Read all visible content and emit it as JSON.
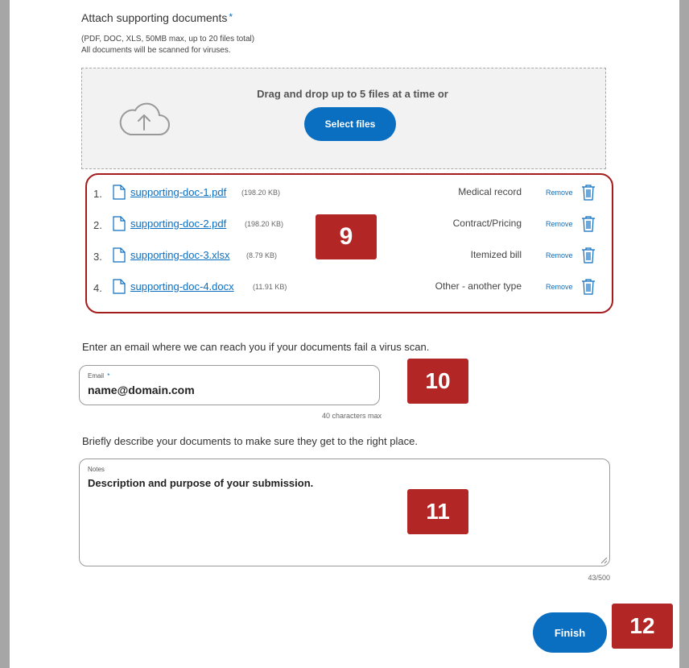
{
  "attach": {
    "title": "Attach supporting documents",
    "required_mark": "*",
    "limits": "(PDF, DOC, XLS, 50MB max, up to 20 files total)",
    "scan_note": "All documents will be scanned for viruses."
  },
  "dropzone": {
    "text": "Drag and drop up to 5 files at a time or",
    "select_label": "Select files",
    "icon": "cloud-upload-icon"
  },
  "files": [
    {
      "num": "1.",
      "name": "supporting-doc-1.pdf",
      "size": "(198.20 KB)",
      "type": "Medical record",
      "remove": "Remove"
    },
    {
      "num": "2.",
      "name": "supporting-doc-2.pdf",
      "size": "(198.20 KB)",
      "type": "Contract/Pricing",
      "remove": "Remove"
    },
    {
      "num": "3.",
      "name": "supporting-doc-3.xlsx",
      "size": "(8.79 KB)",
      "type": "Itemized bill",
      "remove": "Remove"
    },
    {
      "num": "4.",
      "name": "supporting-doc-4.docx",
      "size": "(11.91 KB)",
      "type": "Other - another type",
      "remove": "Remove"
    }
  ],
  "badges": {
    "b9": "9",
    "b10": "10",
    "b11": "11",
    "b12": "12"
  },
  "email": {
    "prompt": "Enter an email where we can reach you if your documents fail a virus scan.",
    "label": "Email",
    "required_mark": "*",
    "value": "name@domain.com",
    "hint": "40 characters max"
  },
  "notes": {
    "prompt": "Briefly describe your documents to make sure they get to the right place.",
    "label": "Notes",
    "value": "Description and purpose of your submission.",
    "count": "43/500"
  },
  "finish_label": "Finish",
  "colors": {
    "accent": "#0a6ec1",
    "highlight": "#b32626"
  }
}
